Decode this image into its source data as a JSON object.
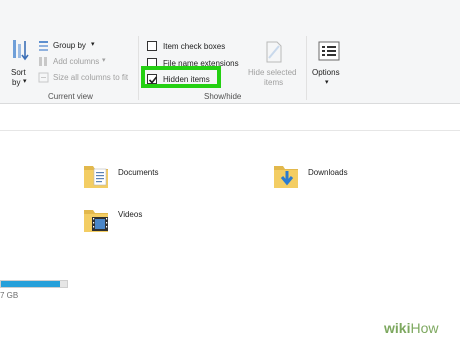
{
  "ribbon": {
    "layout_group": {
      "sort_by_label_1": "Sort",
      "sort_by_label_2": "by",
      "group_by": "Group by",
      "add_columns": "Add columns",
      "size_columns": "Size all columns to fit",
      "caption": "Current view"
    },
    "showhide_group": {
      "item_check_boxes": {
        "label": "Item check boxes",
        "checked": false
      },
      "file_name_extensions": {
        "label": "File name extensions",
        "checked": false
      },
      "hidden_items": {
        "label": "Hidden items",
        "checked": true
      },
      "hide_selected_1": "Hide selected",
      "hide_selected_2": "items",
      "caption": "Show/hide"
    },
    "options_label": "Options"
  },
  "files": [
    {
      "name": "Documents",
      "icon": "documents-folder-icon"
    },
    {
      "name": "Downloads",
      "icon": "downloads-folder-icon"
    },
    {
      "name": "Videos",
      "icon": "videos-folder-icon"
    }
  ],
  "drive": {
    "size_text": "7 GB",
    "used_fraction": 0.9
  },
  "watermark": {
    "brand": "wiki",
    "brand2": "How"
  },
  "colors": {
    "highlight": "#24d012",
    "accent": "#26a0da",
    "folder": "#e8c25a"
  }
}
